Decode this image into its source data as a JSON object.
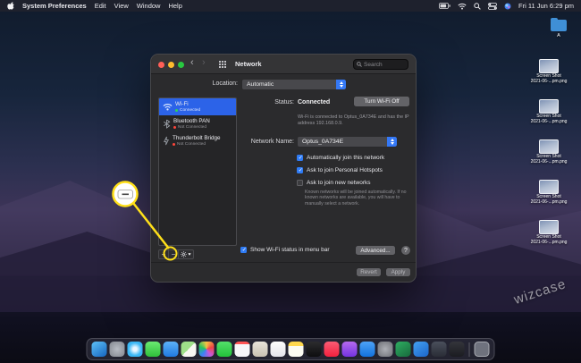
{
  "menu_bar": {
    "items": [
      "System Preferences",
      "Edit",
      "View",
      "Window",
      "Help"
    ],
    "clock": "Fri 11 Jun 6:29 pm"
  },
  "window": {
    "toolbar": {
      "title": "Network",
      "search_placeholder": "Search"
    },
    "location": {
      "label": "Location:",
      "value": "Automatic"
    },
    "sidebar": {
      "items": [
        {
          "name": "Wi-Fi",
          "status": "Connected",
          "selected": true
        },
        {
          "name": "Bluetooth PAN",
          "status": "Not Connected",
          "selected": false
        },
        {
          "name": "Thunderbolt Bridge",
          "status": "Not Connected",
          "selected": false
        }
      ],
      "controls": {
        "add": "+",
        "remove": "−"
      }
    },
    "status": {
      "label": "Status:",
      "value": "Connected",
      "turn_off": "Turn Wi-Fi Off",
      "detail": "Wi-Fi is connected to Optus_0A734E and has the IP address 192.168.0.9."
    },
    "network_name": {
      "label": "Network Name:",
      "value": "Optus_0A734E"
    },
    "options": [
      {
        "label": "Automatically join this network",
        "checked": true
      },
      {
        "label": "Ask to join Personal Hotspots",
        "checked": true
      },
      {
        "label": "Ask to join new networks",
        "checked": false
      }
    ],
    "join_note": "Known networks will be joined automatically. If no known networks are available, you will have to manually select a network.",
    "footer": {
      "menu_checkbox": {
        "label": "Show Wi-Fi status in menu bar",
        "checked": true
      },
      "advanced": "Advanced...",
      "help": "?",
      "revert": "Revert",
      "apply": "Apply"
    }
  },
  "desktop": {
    "folder_label": "A",
    "files": [
      {
        "line1": "Screen Shot",
        "line2": "2021-06-...pm.png"
      },
      {
        "line1": "Screen Shot",
        "line2": "2021-06-...pm.png"
      },
      {
        "line1": "Screen Shot",
        "line2": "2021-06-...pm.png"
      },
      {
        "line1": "Screen Shot",
        "line2": "2021-06-...pm.png"
      },
      {
        "line1": "Screen Shot",
        "line2": "2021-06-...pm.png"
      }
    ]
  },
  "dock": {
    "items": [
      {
        "name": "finder",
        "color": "linear-gradient(145deg,#5ec1f7,#1565c0)"
      },
      {
        "name": "launchpad",
        "color": "radial-gradient(circle,#b8bcc4,#82868e)"
      },
      {
        "name": "safari",
        "color": "radial-gradient(circle,#e8f6ff 18%,#39b7f5 60%)"
      },
      {
        "name": "messages",
        "color": "linear-gradient(180deg,#6bea72,#2fbf3a)"
      },
      {
        "name": "mail",
        "color": "linear-gradient(180deg,#5db1f8,#1f7ae0)"
      },
      {
        "name": "maps",
        "color": "linear-gradient(135deg,#9fe08a 50%,#f7f7f2 50%)"
      },
      {
        "name": "photos",
        "color": "conic-gradient(#f6c244,#ef4444,#c858d8,#3b82f6,#22c55e,#f6c244)"
      },
      {
        "name": "facetime",
        "color": "linear-gradient(180deg,#53e06a,#23c23a)"
      },
      {
        "name": "calendar",
        "color": "linear-gradient(180deg,#f55 18%,#f6f6f8 18%)"
      },
      {
        "name": "contacts",
        "color": "linear-gradient(180deg,#e8e4da,#c9c2b2)"
      },
      {
        "name": "reminders",
        "color": "linear-gradient(180deg,#fdfdfd,#e4e4ea)"
      },
      {
        "name": "notes",
        "color": "linear-gradient(180deg,#ffd84d 30%,#fbfbf2 30%)"
      },
      {
        "name": "tv",
        "color": "linear-gradient(180deg,#2c2c2e,#0d0d0f)"
      },
      {
        "name": "music",
        "color": "linear-gradient(180deg,#fb5c74,#f2203e)"
      },
      {
        "name": "podcasts",
        "color": "linear-gradient(180deg,#b56af0,#7433e0)"
      },
      {
        "name": "app-store",
        "color": "linear-gradient(180deg,#4da2f7,#1272dd)"
      },
      {
        "name": "system-preferences",
        "color": "radial-gradient(circle,#aeb0b6,#6d6f75)"
      },
      {
        "name": "excel",
        "color": "linear-gradient(145deg,#2fae62,#176a3c)"
      },
      {
        "name": "vscode",
        "color": "linear-gradient(145deg,#44a0f2,#1b66c9)"
      },
      {
        "name": "github",
        "color": "linear-gradient(180deg,#4a4f5c,#2a2d36)"
      },
      {
        "name": "terminal",
        "color": "linear-gradient(180deg,#34353b,#1b1c21)"
      },
      {
        "name": "trash",
        "color": "rgba(205,210,220,.45)",
        "divider_before": true
      }
    ]
  },
  "watermark": "wizcase",
  "colors": {
    "accent_blue": "#3478f6",
    "selection_blue": "#2c63e8",
    "connected_green": "#30d158",
    "disconnected_red": "#ff453a",
    "callout_yellow": "#ffe01a"
  }
}
